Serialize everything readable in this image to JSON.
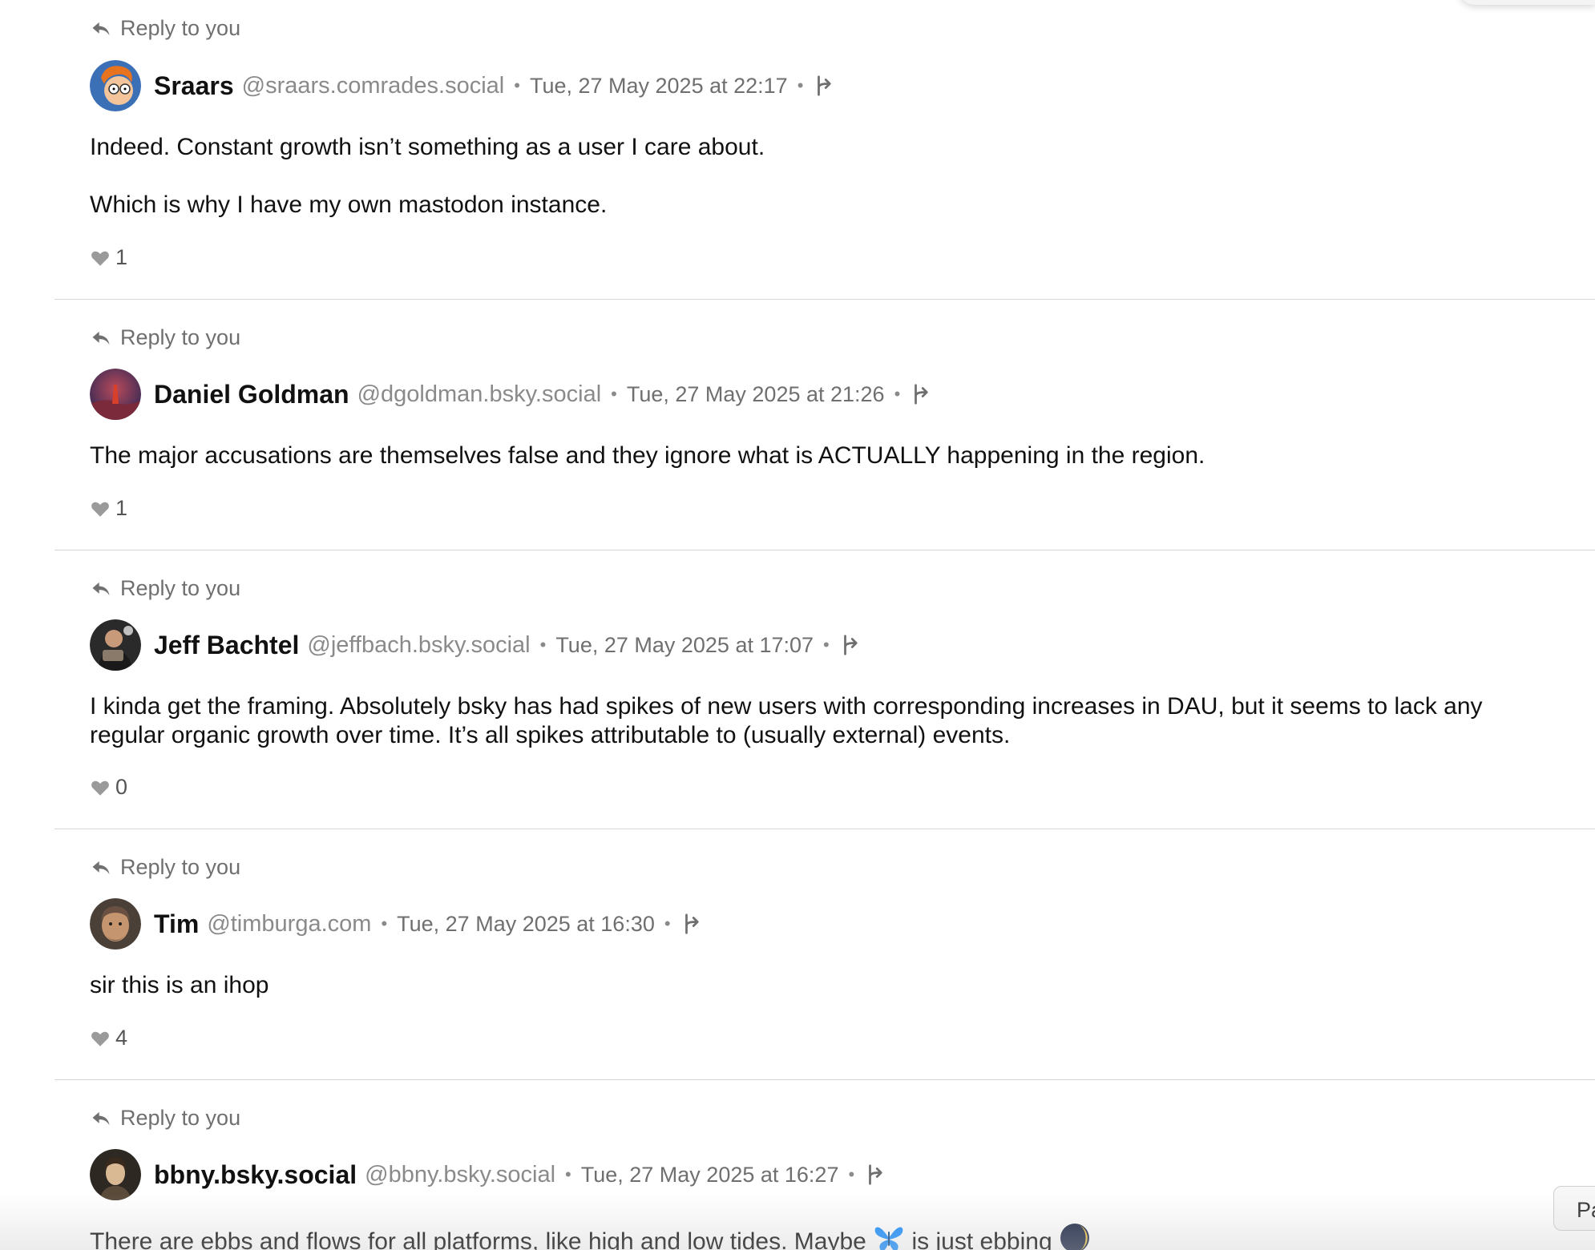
{
  "reply_label": "Reply to you",
  "separator": "•",
  "pager_tab_label": "Pa",
  "posts": [
    {
      "name": "Sraars",
      "handle": "@sraars.comrades.social",
      "time": "Tue, 27 May 2025 at 22:17",
      "paragraphs": [
        "Indeed. Constant growth isn’t something as a user I care about.",
        "Which is why I have my own mastodon instance."
      ],
      "likes": "1"
    },
    {
      "name": "Daniel Goldman",
      "handle": "@dgoldman.bsky.social",
      "time": "Tue, 27 May 2025 at 21:26",
      "paragraphs": [
        "The major accusations are themselves false and they ignore what is ACTUALLY happening in the region."
      ],
      "likes": "1"
    },
    {
      "name": "Jeff Bachtel",
      "handle": "@jeffbach.bsky.social",
      "time": "Tue, 27 May 2025 at 17:07",
      "paragraphs": [
        "I kinda get the framing. Absolutely bsky has had spikes of new users with corresponding increases in DAU, but it seems to lack any regular organic growth over time. It’s all spikes attributable to (usually external) events."
      ],
      "likes": "0"
    },
    {
      "name": "Tim",
      "handle": "@timburga.com",
      "time": "Tue, 27 May 2025 at 16:30",
      "paragraphs": [
        "sir this is an ihop"
      ],
      "likes": "4"
    },
    {
      "name": "bbny.bsky.social",
      "handle": "@bbny.bsky.social",
      "time": "Tue, 27 May 2025 at 16:27",
      "text_before": "There are ebbs and flows for all platforms, like high and low tides. Maybe",
      "text_middle": "is just ebbing",
      "emoji_1": "butterfly-emoji",
      "emoji_2": "moon-emoji"
    }
  ]
}
